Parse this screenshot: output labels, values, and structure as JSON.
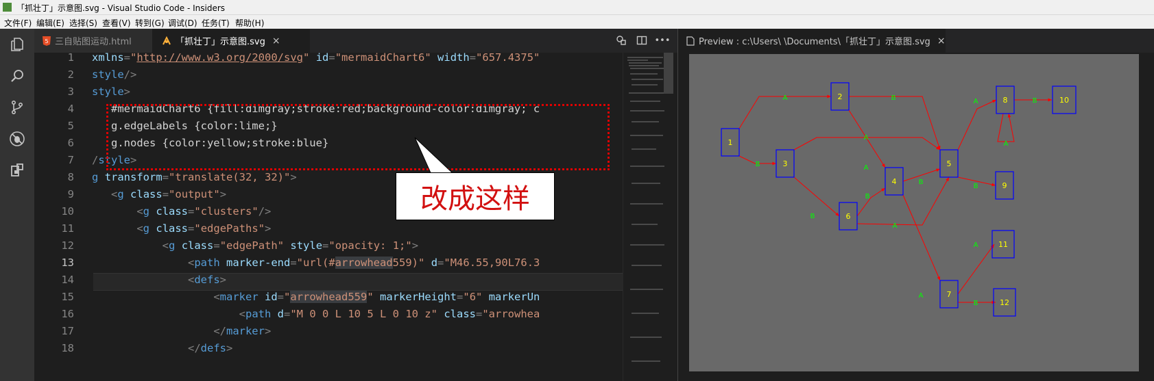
{
  "window": {
    "title": "「抓壮丁」示意图.svg - Visual Studio Code - Insiders"
  },
  "menu": [
    "文件(F)",
    "编辑(E)",
    "选择(S)",
    "查看(V)",
    "转到(G)",
    "调试(D)",
    "任务(T)",
    "帮助(H)"
  ],
  "tabs": {
    "html": {
      "label": "三自贴图运动.html"
    },
    "svg": {
      "label": "「抓壮丁」示意图.svg",
      "close": "×"
    },
    "preview": {
      "label": "Preview : c:\\Users\\        \\Documents\\「抓壮丁」示意图.svg",
      "close": "×"
    }
  },
  "editor": {
    "line_numbers": [
      "1",
      "2",
      "3",
      "4",
      "5",
      "6",
      "7",
      "8",
      "9",
      "10",
      "11",
      "12",
      "13",
      "14",
      "15",
      "16",
      "17",
      "18"
    ],
    "active_line": "13"
  },
  "callout": {
    "text": "改成这样"
  },
  "graph": {
    "nodes": [
      "1",
      "2",
      "3",
      "4",
      "5",
      "6",
      "7",
      "8",
      "9",
      "10",
      "11",
      "12"
    ],
    "edge_label_a": "A",
    "edge_label_b": "B"
  },
  "colors": {
    "canvas": "#696969",
    "edge": "#ff0000",
    "node_stroke": "#0000ff",
    "node_text": "#ffff00",
    "edge_label": "#00ff00",
    "callout_border": "#e00000"
  },
  "icons": {
    "activity": [
      "files-icon",
      "search-icon",
      "source-control-icon",
      "debug-icon",
      "extensions-icon"
    ],
    "editor_actions": [
      "open-changes-icon",
      "split-editor-icon",
      "more-actions-icon"
    ]
  }
}
